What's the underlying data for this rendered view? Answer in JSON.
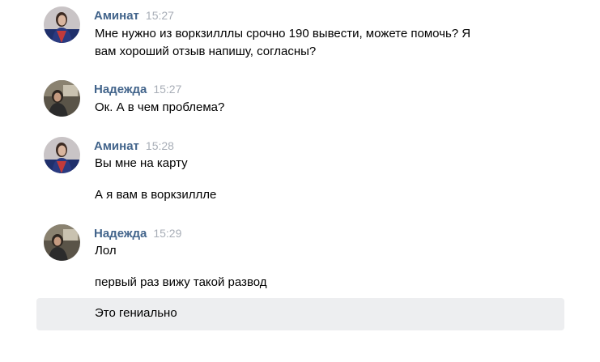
{
  "messages": [
    {
      "author": "Аминат",
      "time": "15:27",
      "avatar": "aminat-avatar",
      "lines": [
        "Мне нужно из воркзилллы срочно 190 вывести, можете помочь? Я",
        "вам хороший отзыв напишу, согласны?"
      ]
    },
    {
      "author": "Надежда",
      "time": "15:27",
      "avatar": "nadezhda-avatar",
      "lines": [
        "Ок. А в чем проблема?"
      ]
    },
    {
      "author": "Аминат",
      "time": "15:28",
      "avatar": "aminat-avatar",
      "lines": [
        "Вы мне на карту",
        "А я вам в воркзиллле"
      ]
    },
    {
      "author": "Надежда",
      "time": "15:29",
      "avatar": "nadezhda-avatar",
      "lines": [
        "Лол",
        "первый раз вижу такой развод",
        "Это гениально"
      ]
    }
  ],
  "colors": {
    "author": "#42648b",
    "time": "#a8aeb7",
    "highlight": "#edeef0"
  }
}
